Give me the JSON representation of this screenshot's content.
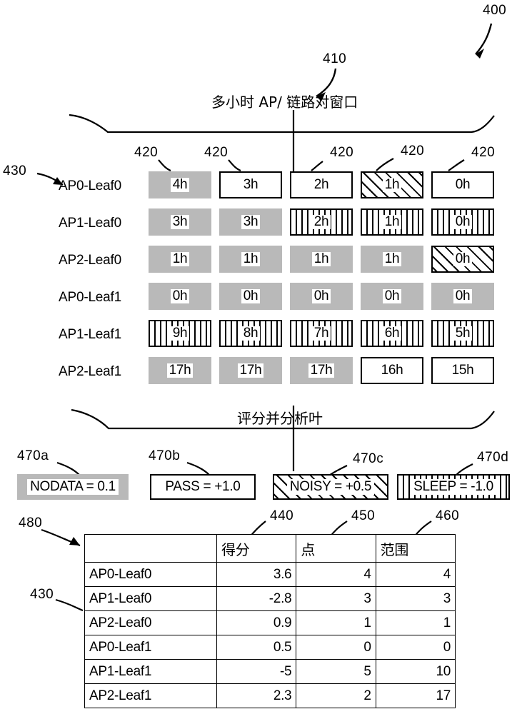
{
  "figure": {
    "number": "400",
    "top_section_ref": "410",
    "cell_ref": "420",
    "row_label_ref": "430",
    "bottom_table_ref": "480",
    "legend_refs": [
      "470a",
      "470b",
      "470c",
      "470d"
    ],
    "column_refs": [
      "440",
      "450",
      "460"
    ]
  },
  "top_section": {
    "title": "多小时 AP/ 链路对窗口",
    "row_labels": [
      "AP0-Leaf0",
      "AP1-Leaf0",
      "AP2-Leaf0",
      "AP0-Leaf1",
      "AP1-Leaf1",
      "AP2-Leaf1"
    ],
    "rows": [
      [
        {
          "value": "4h",
          "state": "nodata"
        },
        {
          "value": "3h",
          "state": "pass"
        },
        {
          "value": "2h",
          "state": "pass"
        },
        {
          "value": "1h",
          "state": "noisy"
        },
        {
          "value": "0h",
          "state": "pass"
        }
      ],
      [
        {
          "value": "3h",
          "state": "nodata"
        },
        {
          "value": "3h",
          "state": "nodata"
        },
        {
          "value": "2h",
          "state": "sleep"
        },
        {
          "value": "1h",
          "state": "sleep"
        },
        {
          "value": "0h",
          "state": "sleep"
        }
      ],
      [
        {
          "value": "1h",
          "state": "nodata"
        },
        {
          "value": "1h",
          "state": "nodata"
        },
        {
          "value": "1h",
          "state": "nodata"
        },
        {
          "value": "1h",
          "state": "nodata"
        },
        {
          "value": "0h",
          "state": "noisy"
        }
      ],
      [
        {
          "value": "0h",
          "state": "nodata"
        },
        {
          "value": "0h",
          "state": "nodata"
        },
        {
          "value": "0h",
          "state": "nodata"
        },
        {
          "value": "0h",
          "state": "nodata"
        },
        {
          "value": "0h",
          "state": "nodata"
        }
      ],
      [
        {
          "value": "9h",
          "state": "sleep"
        },
        {
          "value": "8h",
          "state": "sleep"
        },
        {
          "value": "7h",
          "state": "sleep"
        },
        {
          "value": "6h",
          "state": "sleep"
        },
        {
          "value": "5h",
          "state": "sleep"
        }
      ],
      [
        {
          "value": "17h",
          "state": "nodata"
        },
        {
          "value": "17h",
          "state": "nodata"
        },
        {
          "value": "17h",
          "state": "nodata"
        },
        {
          "value": "16h",
          "state": "pass"
        },
        {
          "value": "15h",
          "state": "pass"
        }
      ]
    ]
  },
  "middle_section": {
    "title": "评分并分析叶"
  },
  "legend": [
    {
      "label": "NODATA = 0.1",
      "state": "nodata",
      "ref": "470a"
    },
    {
      "label": "PASS = +1.0",
      "state": "pass",
      "ref": "470b"
    },
    {
      "label": "NOISY = +0.5",
      "state": "noisy",
      "ref": "470c"
    },
    {
      "label": "SLEEP = -1.0",
      "state": "sleep",
      "ref": "470d"
    }
  ],
  "results_table": {
    "headers": [
      "",
      "得分",
      "点",
      "范围"
    ],
    "rows": [
      {
        "name": "AP0-Leaf0",
        "score": "3.6",
        "points": "4",
        "range": "4"
      },
      {
        "name": "AP1-Leaf0",
        "score": "-2.8",
        "points": "3",
        "range": "3"
      },
      {
        "name": "AP2-Leaf0",
        "score": "0.9",
        "points": "1",
        "range": "1"
      },
      {
        "name": "AP0-Leaf1",
        "score": "0.5",
        "points": "0",
        "range": "0"
      },
      {
        "name": "AP1-Leaf1",
        "score": "-5",
        "points": "5",
        "range": "10"
      },
      {
        "name": "AP2-Leaf1",
        "score": "2.3",
        "points": "2",
        "range": "17"
      }
    ]
  },
  "colors": {
    "nodata_fill": "#b9b9b9",
    "stroke": "#000000",
    "background": "#ffffff"
  }
}
